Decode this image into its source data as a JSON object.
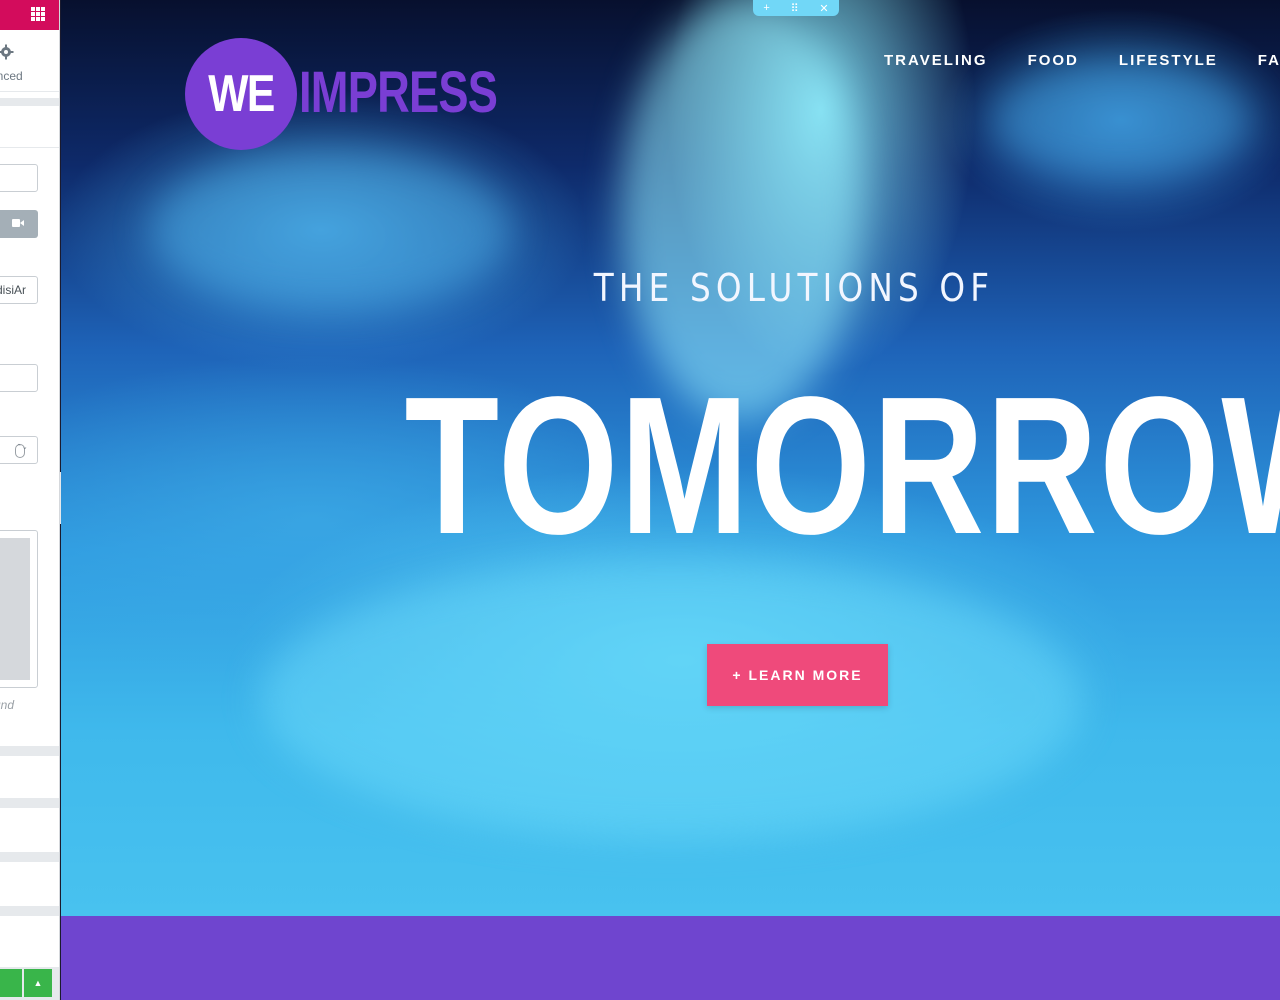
{
  "editor_panel": {
    "tab_label": "anced",
    "field_value": "disiAr",
    "stepper_arrows": "⌃⌄",
    "media_label": "und",
    "collapse_icon": "‹",
    "footer_button": "▲"
  },
  "edit_handle": {
    "add": "+",
    "move": "⠿",
    "close": "✕"
  },
  "site": {
    "logo_we": "WE",
    "logo_impress": "IMPRESS",
    "nav": [
      "TRAVELING",
      "FOOD",
      "LIFESTYLE",
      "FASHI"
    ],
    "hero_subtitle": "THE SOLUTIONS OF",
    "hero_title": "TOMORROW",
    "cta_label": "+ LEARN MORE"
  },
  "colors": {
    "editor_accent": "#d30c5c",
    "logo_purple": "#7a3ed4",
    "cta_pink": "#ef4a7b",
    "section_purple": "#6f45cf",
    "save_green": "#39b54a"
  }
}
